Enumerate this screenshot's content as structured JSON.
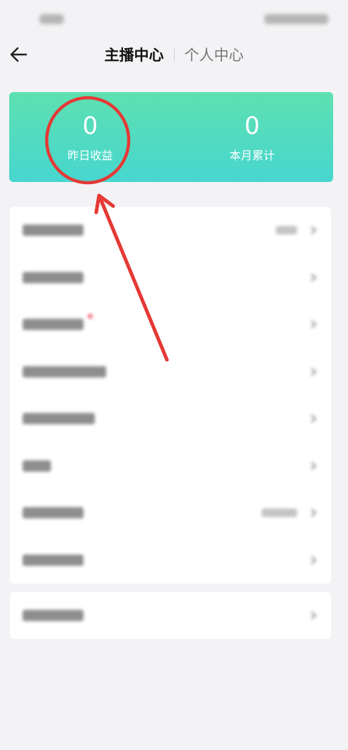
{
  "header": {
    "tabs": [
      {
        "label": "主播中心",
        "active": true
      },
      {
        "label": "个人中心",
        "active": false
      }
    ]
  },
  "earnings": {
    "yesterday": {
      "value": "0",
      "label": "昨日收益"
    },
    "month": {
      "value": "0",
      "label": "本月累计"
    }
  },
  "menu": {
    "row_count": 8,
    "single_row_count": 1
  },
  "colors": {
    "accent_start": "#5ee0b0",
    "accent_end": "#47d6d0",
    "annotation": "#e53935",
    "badge": "#f06b7e"
  },
  "icons": {
    "back": "arrow-left-icon",
    "chevron": "chevron-right-icon"
  }
}
